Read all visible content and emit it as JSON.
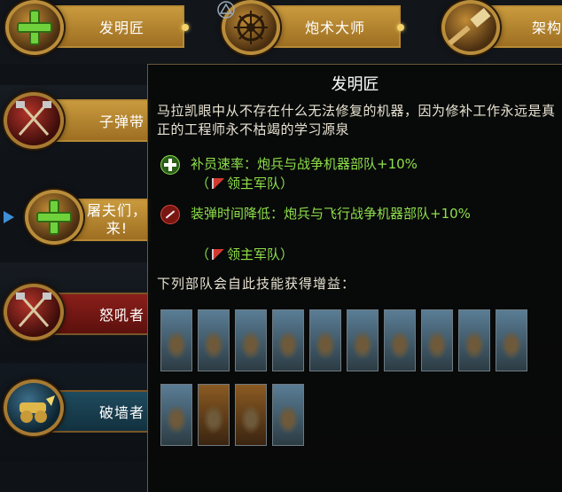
{
  "skill_tree": {
    "top_row": [
      {
        "label": "发明匠",
        "icon": "plus-icon",
        "color": "gold"
      },
      {
        "label": "炮术大师",
        "icon": "cannon-emblem-icon",
        "color": "gold"
      },
      {
        "label": "架构",
        "icon": "hammer-icon",
        "color": "gold"
      }
    ],
    "left_column": [
      {
        "label": "子弹带",
        "icon": "crossed-axes-icon",
        "color": "gold"
      },
      {
        "label": "屠夫们，\n来!",
        "icon": "plus-icon",
        "color": "gold"
      },
      {
        "label": "怒吼者",
        "icon": "crossed-axes-icon",
        "color": "red"
      },
      {
        "label": "破墙者",
        "icon": "cannon-icon",
        "color": "blue"
      }
    ],
    "top_icon": "triangle-circle-icon"
  },
  "tooltip": {
    "title": "发明匠",
    "description": "马拉凯眼中从不存在什么无法修复的机器，因为修补工作永远是真正的工程师永不枯竭的学习源泉",
    "effects": [
      {
        "icon": "plus-green-icon",
        "text": "补员速率：炮兵与战争机器部队+10%",
        "source": "领主军队"
      },
      {
        "icon": "reload-red-icon",
        "text": "装弹时间降低：炮兵与飞行战争机器部队+10%",
        "source": "领主军队"
      }
    ],
    "units_header": "下列部队会自此技能获得增益：",
    "unit_cards": [
      "airship-card",
      "gyrocopter-card",
      "gyrocopter-card-2",
      "gyrobomber-card",
      "gyrobomber-card-2",
      "gyrocopter-card-3",
      "cannon-crew-card",
      "cannon-crew-card-2",
      "grudge-thrower-card",
      "flame-cannon-card",
      "organ-gun-card",
      "irondrakes-card",
      "irondrakes-card-2",
      "bolt-thrower-card"
    ]
  },
  "colors": {
    "accent_green": "#8ee04a",
    "banner_gold": "#c99a3d",
    "border_gold": "#b98d3a"
  }
}
